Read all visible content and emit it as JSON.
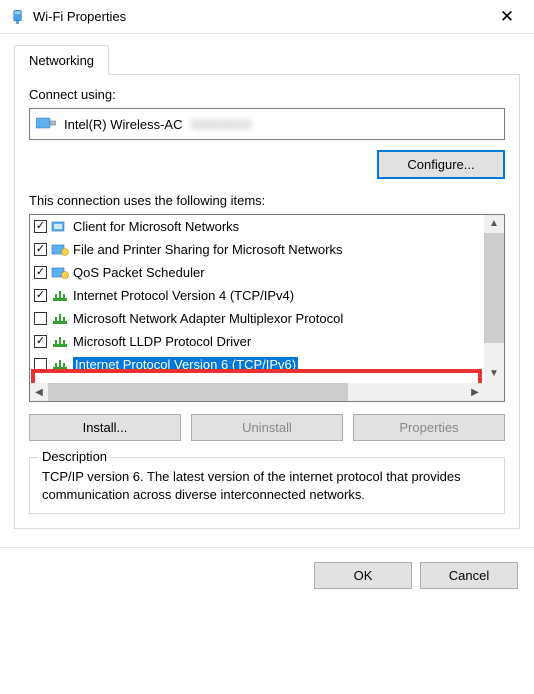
{
  "window": {
    "title": "Wi-Fi Properties",
    "close_glyph": "✕"
  },
  "tabs": {
    "networking": "Networking"
  },
  "connect_using_label": "Connect using:",
  "adapter": {
    "name": "Intel(R) Wireless-AC",
    "hidden": "XXXXXXX"
  },
  "configure_label": "Configure...",
  "items_label": "This connection uses the following items:",
  "items": [
    {
      "checked": true,
      "icon": "client",
      "label": "Client for Microsoft Networks"
    },
    {
      "checked": true,
      "icon": "service",
      "label": "File and Printer Sharing for Microsoft Networks"
    },
    {
      "checked": true,
      "icon": "service",
      "label": "QoS Packet Scheduler"
    },
    {
      "checked": true,
      "icon": "proto",
      "label": "Internet Protocol Version 4 (TCP/IPv4)"
    },
    {
      "checked": false,
      "icon": "proto",
      "label": "Microsoft Network Adapter Multiplexor Protocol"
    },
    {
      "checked": true,
      "icon": "proto",
      "label": "Microsoft LLDP Protocol Driver"
    },
    {
      "checked": false,
      "icon": "proto",
      "label": "Internet Protocol Version 6 (TCP/IPv6)",
      "selected": true
    }
  ],
  "check_glyph": "✓",
  "vscroll": {
    "up": "▲",
    "down": "▼"
  },
  "hscroll": {
    "left": "◀",
    "right": "▶"
  },
  "buttons": {
    "install": "Install...",
    "uninstall": "Uninstall",
    "properties": "Properties",
    "ok": "OK",
    "cancel": "Cancel"
  },
  "description": {
    "legend": "Description",
    "text": "TCP/IP version 6. The latest version of the internet protocol that provides communication across diverse interconnected networks."
  }
}
